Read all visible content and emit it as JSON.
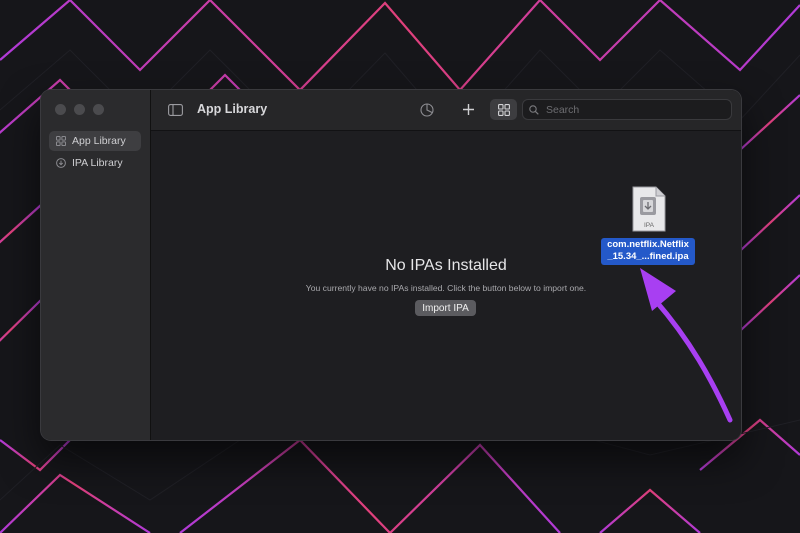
{
  "window": {
    "title": "App Library"
  },
  "sidebar": {
    "items": [
      {
        "label": "App Library",
        "icon": "grid-icon",
        "active": true
      },
      {
        "label": "IPA Library",
        "icon": "download-circle-icon",
        "active": false
      }
    ]
  },
  "toolbar": {
    "icons": [
      "sidebar-toggle-icon",
      "pie-chart-icon",
      "plus-icon",
      "grid-view-icon",
      "list-view-icon"
    ],
    "search_placeholder": "Search"
  },
  "main": {
    "empty_title": "No IPAs Installed",
    "empty_message": "You currently have no IPAs installed. Click the button below to import one.",
    "import_button": "Import IPA"
  },
  "dragged_file": {
    "icon_text": "IPA",
    "name_line1": "com.netflix.Netflix",
    "name_line2": "_15.34_...fined.ipa"
  },
  "colors": {
    "background": "#16161a",
    "accent_pink": "#e0407a",
    "accent_purple": "#b03ad8",
    "arrow": "#a83ff2",
    "selection_blue": "#2459c9"
  }
}
